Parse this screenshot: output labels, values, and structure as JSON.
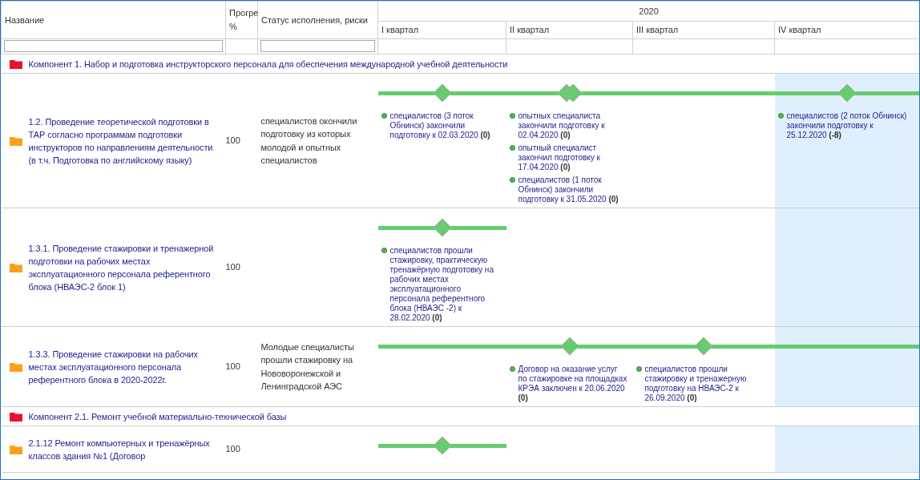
{
  "columns": [
    {
      "kind": "name",
      "label": "Название",
      "filter": true
    },
    {
      "kind": "progress",
      "label": "Прогре %",
      "filter": false
    },
    {
      "kind": "status",
      "label": "Статус исполнения, риски",
      "filter": true
    }
  ],
  "timeline": {
    "year": "2020",
    "quarters": [
      {
        "label": "I квартал",
        "current": false
      },
      {
        "label": "II квартал",
        "current": false
      },
      {
        "label": "III квартал",
        "current": false
      },
      {
        "label": "IV квартал",
        "current": true
      }
    ]
  },
  "rows": [
    {
      "kind": "component",
      "title": "Компонент 1. Набор и подготовка инструкторского персонала для обеспечения международной учебной деятельности"
    },
    {
      "kind": "task",
      "title": "1.2. Проведение теоретической подготовки в ТАР согласно программам подготовки инструкторов по направлениям деятельности (в т.ч. Подготовка по английскому языку)",
      "progress": "100",
      "status": "специалистов окончили подготовку из которых молодой и опытных специалистов",
      "quarters": [
        {
          "bar": true,
          "markers": [
            {
              "kind": "diamond"
            }
          ],
          "milestones": [
            "специалистов (3 поток Обнинск) закончили подготовку к 02.03.2020 **(0)**"
          ]
        },
        {
          "bar": true,
          "markers": [
            {
              "kind": "double"
            }
          ],
          "milestones": [
            "опытных специалиста закончили подготовку к 02.04.2020 **(0)**",
            "опытный специалист закончил подготовку к 17.04.2020 **(0)**",
            "специалистов (1 поток Обнинск) закончили подготовку к 31.05.2020 **(0)**"
          ]
        },
        {
          "bar": true
        },
        {
          "bar": true,
          "markers": [
            {
              "kind": "diamond"
            }
          ],
          "milestones": [
            "специалистов (2 поток Обнинск) закончили подготовку к 25.12.2020 **(-8)**"
          ]
        }
      ]
    },
    {
      "kind": "task",
      "title": "1.3.1. Проведение стажировки и тренажерной подготовки на рабочих местах эксплуатационного персонала референтного блока (НВАЭС-2 блок 1)",
      "progress": "100",
      "quarters": [
        {
          "bar": true,
          "markers": [
            {
              "kind": "diamond"
            }
          ],
          "milestones": [
            "специалистов прошли стажировку, практическую тренажёрную подготовку на рабочих местах эксплуатационного персонала референтного блока (НВАЭС -2) к 28.02.2020 **(0)**"
          ]
        },
        {
          "bar": false
        },
        {
          "bar": false
        },
        {
          "bar": false
        }
      ]
    },
    {
      "kind": "task",
      "title": "1.3.3. Проведение стажировки на рабочих местах эксплуатационного персонала референтного блока в 2020-2022г.",
      "progress": "100",
      "status": "Молодые специалисты прошли стажировку на Нововоронежской и Ленинградской АЭС",
      "quarters": [
        {
          "bar": true
        },
        {
          "bar": true,
          "markers": [
            {
              "kind": "diamond"
            }
          ],
          "milestones": [
            "Договор на оказание услуг по стажировке на площадках КРЭА заключен к 20.06.2020 **(0)**"
          ]
        },
        {
          "bar": true,
          "markers": [
            {
              "kind": "diamond"
            }
          ],
          "milestones": [
            "специалистов прошли стажировку и тренажерную подготовку на НВАЭС-2 к 26.09.2020 **(0)**"
          ]
        },
        {
          "bar": true
        }
      ]
    },
    {
      "kind": "component",
      "title": "Компонент 2.1. Ремонт учебной материально-технической базы"
    },
    {
      "kind": "task",
      "title": "2.1.12 Ремонт компьютерных и тренажёрных классов здания №1 (Договор",
      "progress": "100",
      "quarters": [
        {
          "bar": true,
          "markers": [
            {
              "kind": "diamond"
            }
          ]
        },
        {
          "bar": false
        },
        {
          "bar": false
        },
        {
          "bar": false
        }
      ]
    }
  ]
}
